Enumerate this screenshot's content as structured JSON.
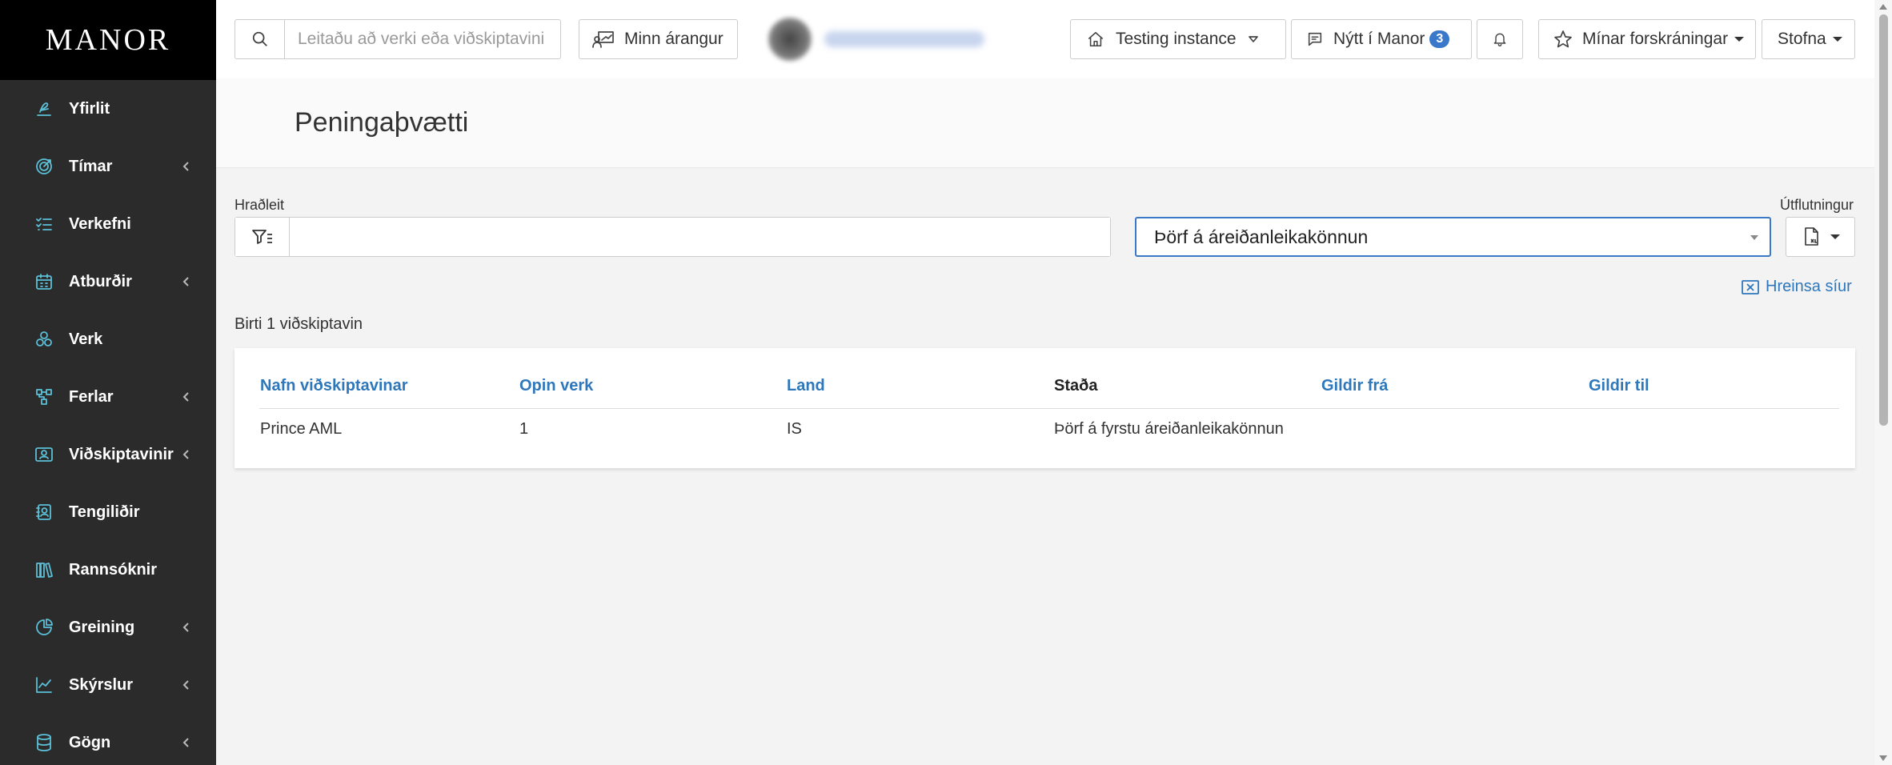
{
  "brand": "MANOR",
  "sidebar": {
    "items": [
      {
        "label": "Yfirlit",
        "icon": "signature-icon",
        "has_chevron": false
      },
      {
        "label": "Tímar",
        "icon": "target-icon",
        "has_chevron": true
      },
      {
        "label": "Verkefni",
        "icon": "list-check-icon",
        "has_chevron": false
      },
      {
        "label": "Atburðir",
        "icon": "calendar-icon",
        "has_chevron": true
      },
      {
        "label": "Verk",
        "icon": "cubes-icon",
        "has_chevron": false
      },
      {
        "label": "Ferlar",
        "icon": "flow-icon",
        "has_chevron": true
      },
      {
        "label": "Viðskiptavinir",
        "icon": "users-card-icon",
        "has_chevron": true
      },
      {
        "label": "Tengiliðir",
        "icon": "contact-card-icon",
        "has_chevron": false
      },
      {
        "label": "Rannsóknir",
        "icon": "books-icon",
        "has_chevron": false
      },
      {
        "label": "Greining",
        "icon": "pie-chart-icon",
        "has_chevron": true
      },
      {
        "label": "Skýrslur",
        "icon": "line-chart-icon",
        "has_chevron": true
      },
      {
        "label": "Gögn",
        "icon": "database-icon",
        "has_chevron": true
      }
    ]
  },
  "topbar": {
    "search_placeholder": "Leitaðu að verki eða viðskiptavini",
    "my_results_label": "Minn árangur",
    "instance_label": "Testing instance",
    "news_label": "Nýtt í Manor",
    "news_count": "3",
    "registrations_label": "Mínar forskráningar",
    "create_label": "Stofna"
  },
  "page": {
    "title": "Peningaþvætti"
  },
  "filters": {
    "quick_search_label": "Hraðleit",
    "quick_search_value": "",
    "status_selected": "Þörf á áreiðanleikakönnun",
    "export_label": "Útflutningur",
    "clear_label": "Hreinsa síur"
  },
  "results": {
    "count_text": "Birti 1 viðskiptavin"
  },
  "table": {
    "columns": [
      "Nafn viðskiptavinar",
      "Opin verk",
      "Land",
      "Staða",
      "Gildir frá",
      "Gildir til"
    ],
    "rows": [
      [
        "Prince AML",
        "1",
        "IS",
        "Þörf á fyrstu áreiðanleikakönnun",
        "",
        ""
      ]
    ]
  },
  "colors": {
    "accent": "#2e77bb",
    "sidebar_bg": "#2b2b2b",
    "sidebar_icon": "#5bc0d8",
    "badge": "#3a78c9"
  }
}
